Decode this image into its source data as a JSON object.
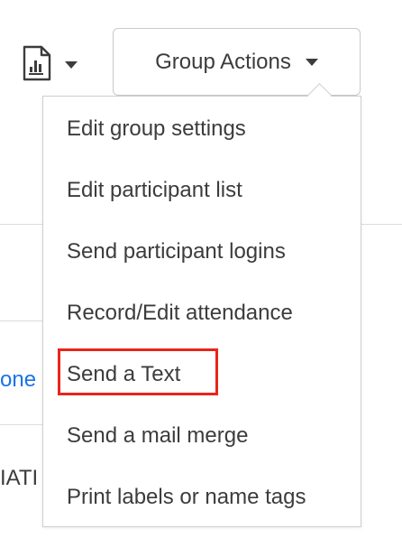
{
  "background": {
    "link_fragment": "one",
    "text_fragment": "IATI"
  },
  "toolbar": {
    "report_icon": "report-document-icon",
    "group_actions_label": "Group Actions"
  },
  "menu": {
    "items": [
      {
        "label": "Edit group settings"
      },
      {
        "label": "Edit participant list"
      },
      {
        "label": "Send participant logins"
      },
      {
        "label": "Record/Edit attendance"
      },
      {
        "label": "Send a Text"
      },
      {
        "label": "Send a mail merge"
      },
      {
        "label": "Print labels or name tags"
      }
    ]
  },
  "colors": {
    "highlight": "#e8251b",
    "link": "#1a73e8",
    "text": "#3c3c3c"
  }
}
